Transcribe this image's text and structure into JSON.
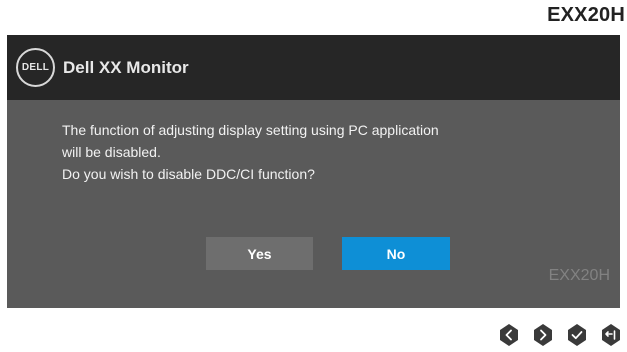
{
  "page": {
    "model_label": "EXX20H"
  },
  "osd": {
    "logo_text": "DELL",
    "title": "Dell XX Monitor",
    "message_lines": [
      "The function of adjusting display setting using PC application",
      "will be disabled.",
      "Do you wish to disable DDC/CI function?"
    ],
    "yes_label": "Yes",
    "no_label": "No",
    "model_label": "EXX20H",
    "colors": {
      "header_bg": "#262626",
      "body_bg": "#5a5a5a",
      "selected_button": "#0e8fd6",
      "unselected_button": "#6e6e6e"
    }
  },
  "nav_buttons": [
    {
      "icon": "chevron-left-icon"
    },
    {
      "icon": "chevron-right-icon"
    },
    {
      "icon": "checkmark-icon"
    },
    {
      "icon": "exit-icon"
    }
  ]
}
